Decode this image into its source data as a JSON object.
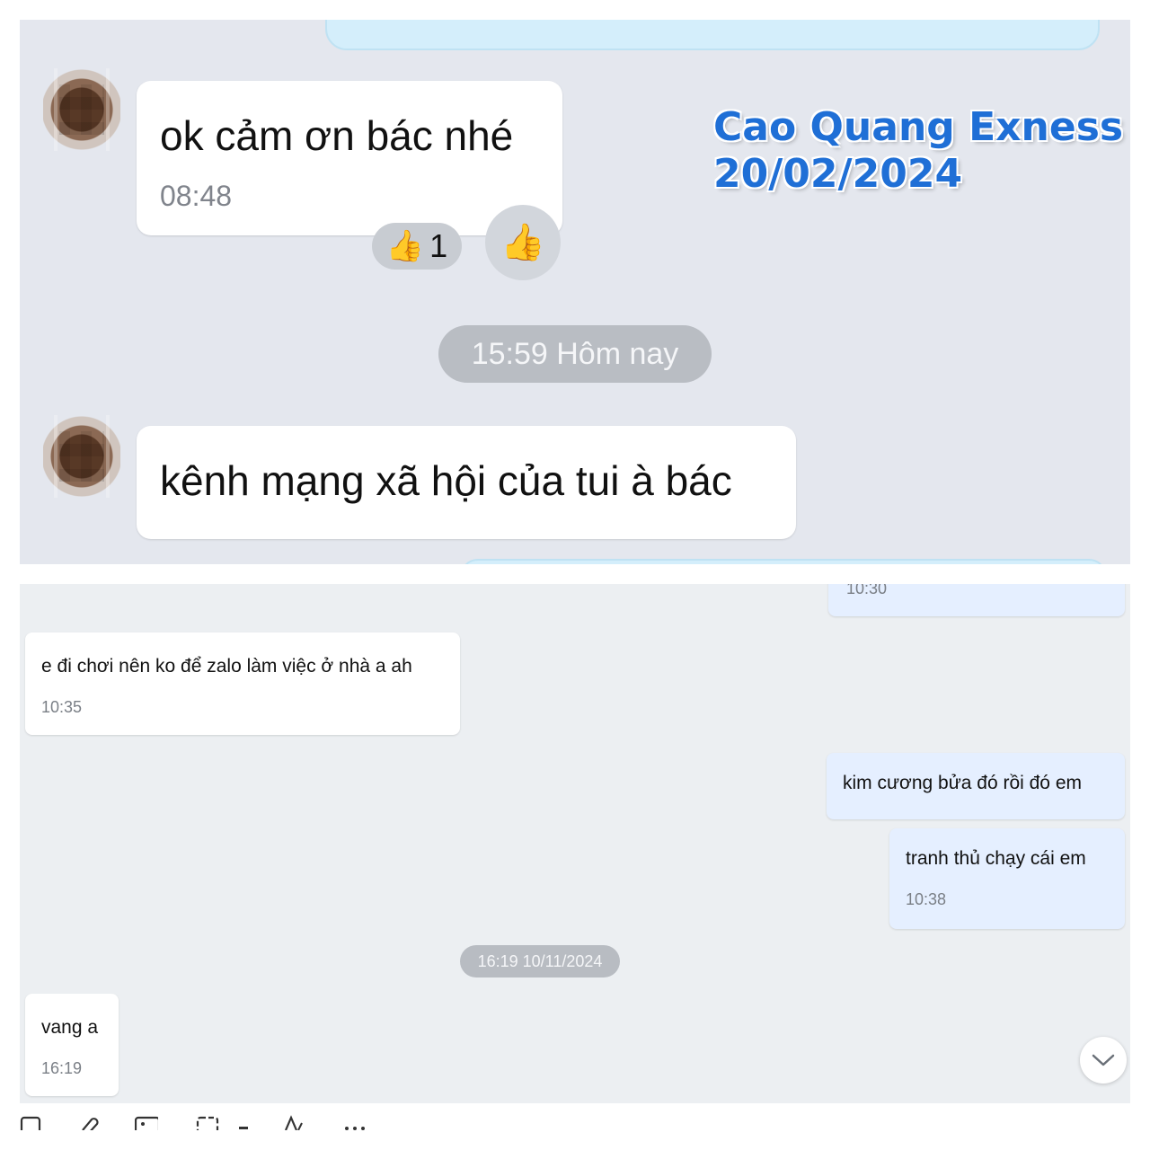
{
  "top": {
    "messages": [
      {
        "text": "ok cảm ơn bác nhé",
        "time": "08:48"
      },
      {
        "text": "kênh mạng xã hội của tui à bác"
      }
    ],
    "reaction": {
      "icon": "thumbs-up-icon",
      "count": "1"
    },
    "date_separator": "15:59 Hôm nay",
    "watermark": {
      "line1": "Cao Quang Exness",
      "line2": "20/02/2024"
    }
  },
  "bottom": {
    "partial_time": "10:30",
    "messages": [
      {
        "side": "left",
        "text": "e đi chơi nên ko để zalo làm việc ở nhà a ah",
        "time": "10:35"
      },
      {
        "side": "right",
        "text": "kim cương bửa đó rồi đó em"
      },
      {
        "side": "right",
        "text": "tranh thủ chạy cái em",
        "time": "10:38"
      },
      {
        "side": "left",
        "text": "vang a",
        "time": "16:19"
      }
    ],
    "date_separator": "16:19 10/11/2024"
  },
  "colors": {
    "top_bg": "#e4e7ee",
    "bottom_bg": "#eceff2",
    "my_bubble": "#e5efff",
    "watermark": "#1f6fd6"
  }
}
